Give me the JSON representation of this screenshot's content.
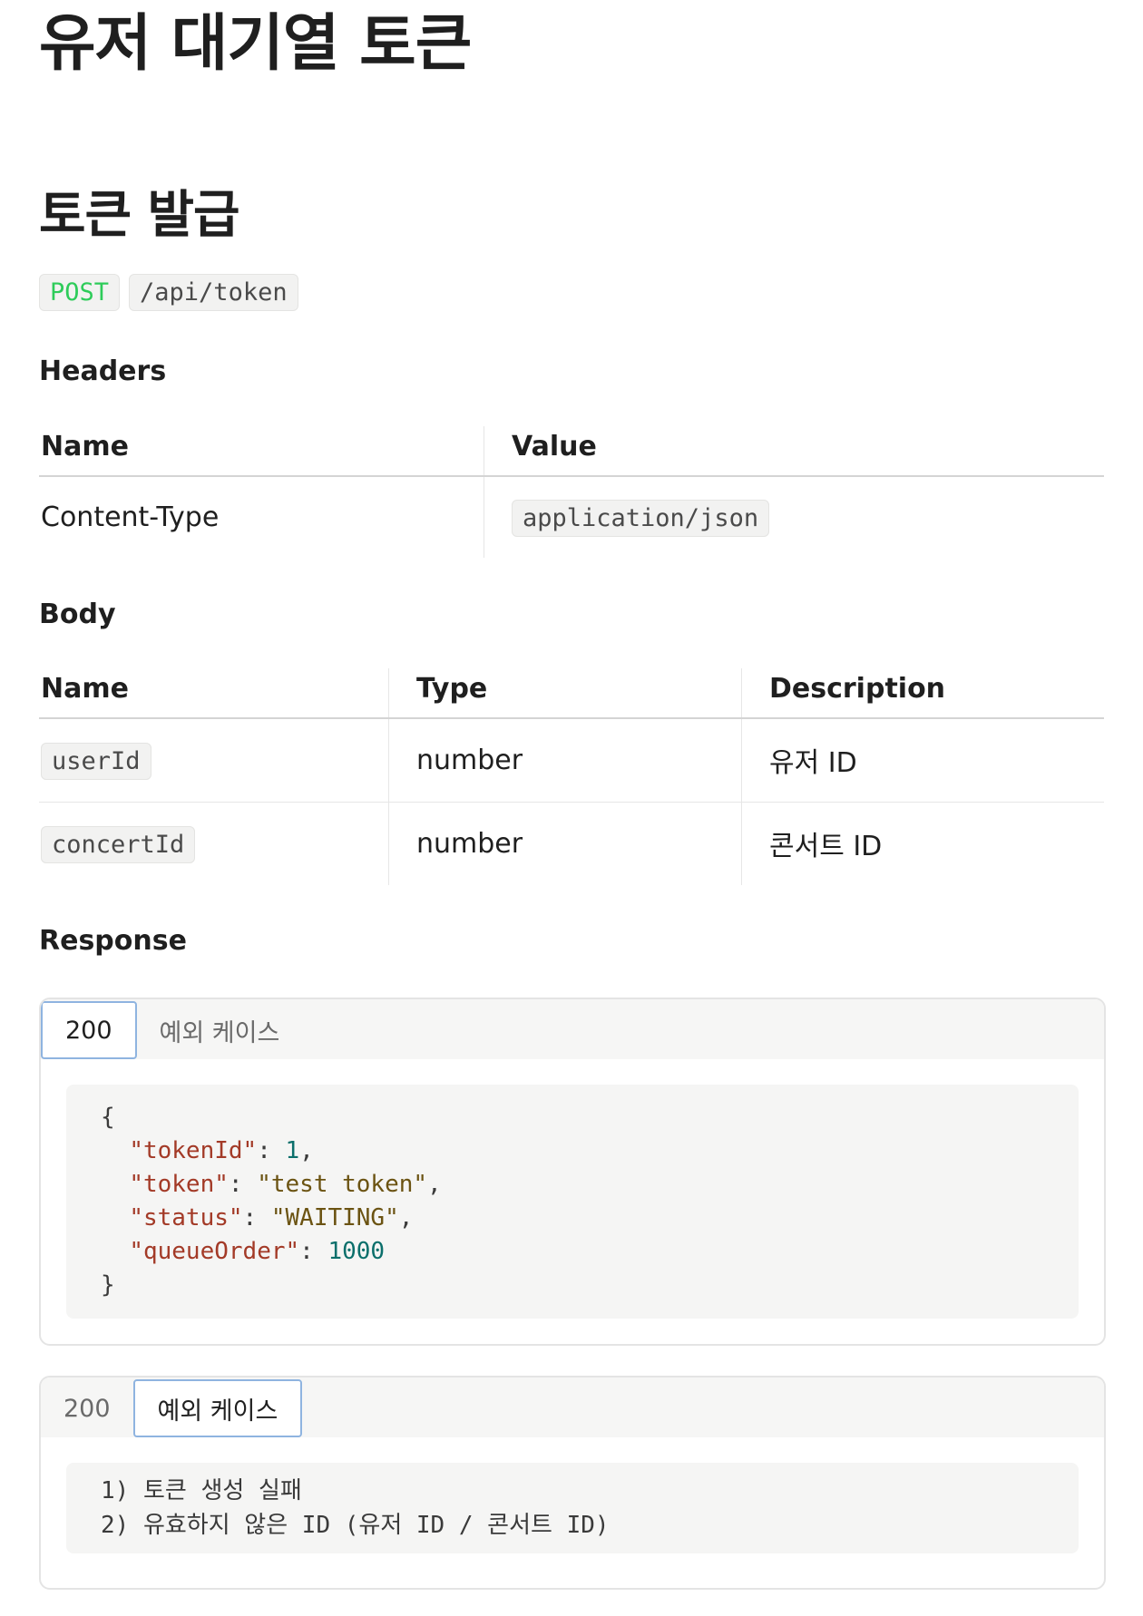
{
  "page": {
    "title": "유저 대기열 토큰",
    "section_title": "토큰 발급"
  },
  "endpoint": {
    "method": "POST",
    "path": "/api/token"
  },
  "headers": {
    "heading": "Headers",
    "columns": [
      "Name",
      "Value"
    ],
    "rows": [
      {
        "name": "Content-Type",
        "value": "application/json"
      }
    ]
  },
  "body": {
    "heading": "Body",
    "columns": [
      "Name",
      "Type",
      "Description"
    ],
    "rows": [
      {
        "name": "userId",
        "type": "number",
        "description": "유저 ID"
      },
      {
        "name": "concertId",
        "type": "number",
        "description": "콘서트 ID"
      }
    ]
  },
  "response": {
    "heading": "Response",
    "tabs": [
      "200",
      "예외 케이스"
    ],
    "success_json": {
      "tokenId_key": "\"tokenId\"",
      "tokenId_value": "1",
      "token_key": "\"token\"",
      "token_value": "\"test token\"",
      "status_key": "\"status\"",
      "status_value": "\"WAITING\"",
      "queueOrder_key": "\"queueOrder\"",
      "queueOrder_value": "1000"
    },
    "error_lines": [
      "1) 토큰 생성 실패",
      "2) 유효하지 않은 ID (유저 ID / 콘서트 ID)"
    ]
  }
}
